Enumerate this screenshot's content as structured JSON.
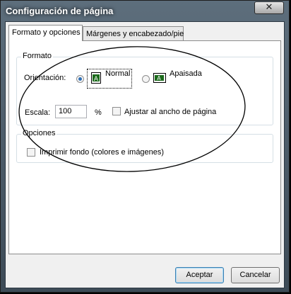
{
  "window": {
    "title": "Configuración de página",
    "close_glyph": "✕"
  },
  "tabs": [
    {
      "label": "Formato y opciones",
      "active": true
    },
    {
      "label": "Márgenes y encabezado/pie",
      "active": false
    }
  ],
  "format_group": {
    "title": "Formato",
    "orientation_label": "Orientación:",
    "portrait_label": "Normal",
    "landscape_label": "Apaisada",
    "portrait_selected": true,
    "scale_label": "Escala:",
    "scale_value": "100",
    "percent_label": "%",
    "fit_width_label": "Ajustar al ancho de página",
    "fit_width_checked": false
  },
  "options_group": {
    "title": "Opciones",
    "print_background_label": "Imprimir fondo (colores e imágenes)",
    "print_background_checked": false
  },
  "buttons": {
    "accept": "Aceptar",
    "cancel": "Cancelar"
  }
}
